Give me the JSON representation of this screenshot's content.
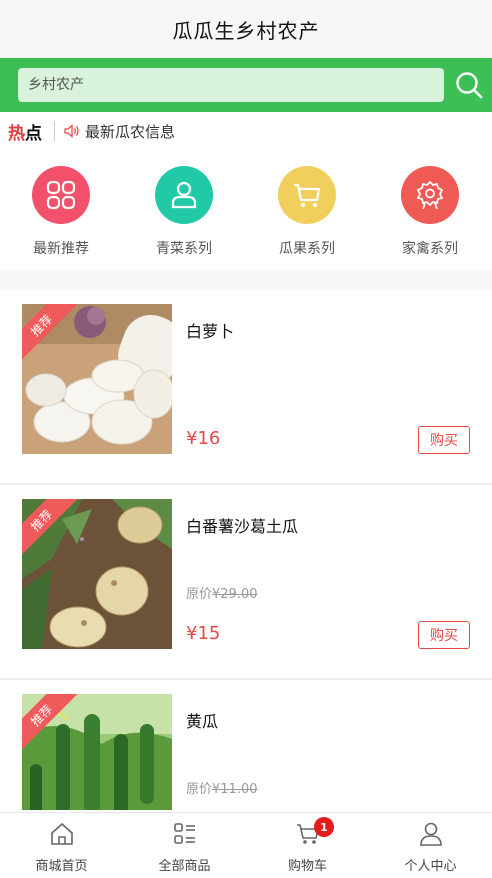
{
  "header": {
    "title": "瓜瓜生乡村农产"
  },
  "search": {
    "placeholder": "乡村农产"
  },
  "hot": {
    "badge_left": "热",
    "badge_right": "点",
    "news": "最新瓜农信息"
  },
  "categories": [
    {
      "label": "最新推荐",
      "color": "#f2506b",
      "icon": "grid-icon"
    },
    {
      "label": "青菜系列",
      "color": "#22c9a7",
      "icon": "person-icon"
    },
    {
      "label": "瓜果系列",
      "color": "#f0cf5c",
      "icon": "cart-icon"
    },
    {
      "label": "家禽系列",
      "color": "#f05a55",
      "icon": "medal-icon"
    }
  ],
  "products": [
    {
      "ribbon": "推荐",
      "name": "白萝卜",
      "original": "",
      "price": "¥16",
      "buy": "购买",
      "image": "radish"
    },
    {
      "ribbon": "推荐",
      "name": "白番薯沙葛土瓜",
      "original_label": "原价",
      "original_price": "¥29.00",
      "price": "¥15",
      "buy": "购买",
      "image": "potato"
    },
    {
      "ribbon": "推荐",
      "name": "黄瓜",
      "original_label": "原价",
      "original_price": "¥11.00",
      "price": "",
      "buy": "",
      "image": "cucumber"
    }
  ],
  "tabbar": {
    "home": "商城首页",
    "all": "全部商品",
    "cart": "购物车",
    "cart_count": "1",
    "me": "个人中心"
  },
  "colors": {
    "brand_green": "#3cbf55",
    "price_red": "#e84848"
  }
}
